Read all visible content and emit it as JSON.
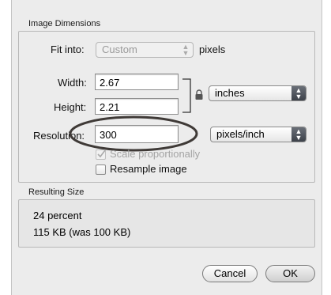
{
  "sections": {
    "image_dimensions": "Image Dimensions",
    "resulting_size": "Resulting Size"
  },
  "fit_into": {
    "label": "Fit into:",
    "value": "Custom",
    "unit": "pixels"
  },
  "width": {
    "label": "Width:",
    "value": "2.67"
  },
  "height": {
    "label": "Height:",
    "value": "2.21"
  },
  "resolution": {
    "label": "Resolution:",
    "value": "300"
  },
  "size_unit": {
    "value": "inches"
  },
  "resolution_unit": {
    "value": "pixels/inch"
  },
  "scale_proportionally": {
    "label": "Scale proportionally",
    "checked": true,
    "enabled": false
  },
  "resample_image": {
    "label": "Resample image",
    "checked": false,
    "enabled": true
  },
  "result": {
    "percent": "24 percent",
    "size": "115 KB (was 100 KB)"
  },
  "buttons": {
    "cancel": "Cancel",
    "ok": "OK"
  },
  "icons": {
    "lock": "lock-icon",
    "checkmark": "checkmark-icon",
    "updown": "up-down-arrows-icon"
  },
  "colors": {
    "dialog_bg": "#ececec",
    "annotation_ring": "#3f3a37"
  }
}
